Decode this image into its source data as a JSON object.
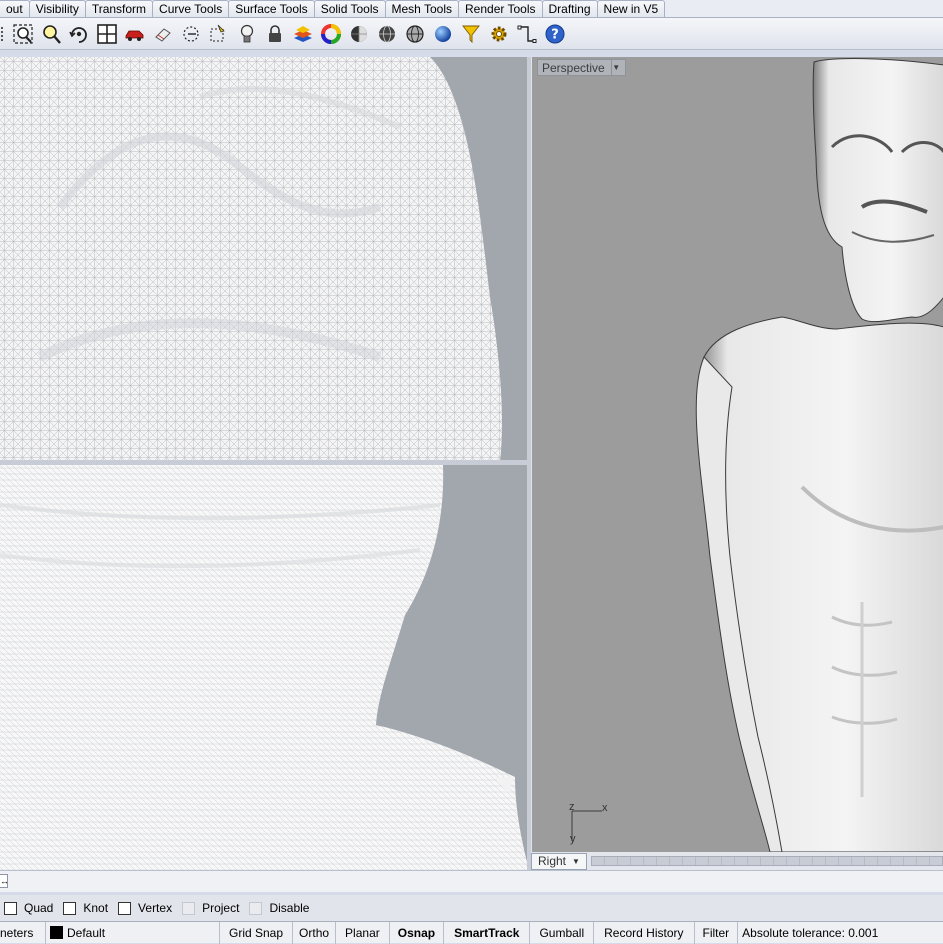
{
  "tabs": [
    "out",
    "Visibility",
    "Transform",
    "Curve Tools",
    "Surface Tools",
    "Solid Tools",
    "Mesh Tools",
    "Render Tools",
    "Drafting",
    "New in V5"
  ],
  "toolbar": {
    "icons": [
      "zoom-window-icon",
      "zoom-extents-icon",
      "rotate-view-icon",
      "four-viewports-icon",
      "car-icon",
      "eraser-icon",
      "circle-snap-icon",
      "named-view-icon",
      "light-bulb-icon",
      "lock-icon",
      "layer-icon",
      "color-wheel-icon",
      "shaded-sphere-icon",
      "wireframe-sphere-icon",
      "render-sphere-icon",
      "filter-icon",
      "options-gear-icon",
      "dimension-icon",
      "help-icon"
    ]
  },
  "viewports": {
    "perspective_label": "Perspective",
    "right_label": "Right",
    "axis_z": "z",
    "axis_x": "x",
    "axis_y": "y"
  },
  "command": {
    "icon": "↔"
  },
  "osnap": {
    "items": [
      {
        "label": "Quad",
        "checked": false,
        "enabled": true
      },
      {
        "label": "Knot",
        "checked": false,
        "enabled": true
      },
      {
        "label": "Vertex",
        "checked": false,
        "enabled": true
      },
      {
        "label": "Project",
        "checked": false,
        "enabled": false
      },
      {
        "label": "Disable",
        "checked": false,
        "enabled": false
      }
    ]
  },
  "status": {
    "units": "neters",
    "layer": "Default",
    "grid_snap": "Grid Snap",
    "ortho": "Ortho",
    "planar": "Planar",
    "osnap": "Osnap",
    "smarttrack": "SmartTrack",
    "gumball": "Gumball",
    "record_history": "Record History",
    "filter": "Filter",
    "tolerance": "Absolute tolerance: 0.001"
  },
  "colors": {
    "layer_swatch": "#000000",
    "viewport_bg": "#a2a7ae",
    "perspective_bg": "#9c9c9c"
  }
}
